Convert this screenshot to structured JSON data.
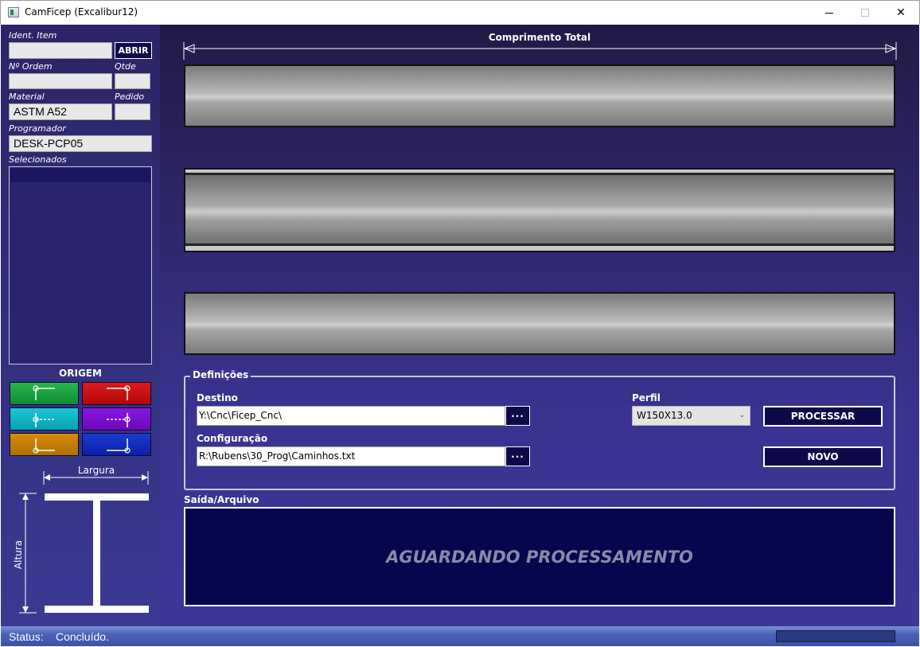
{
  "window": {
    "title": "CamFicep (Excalibur12)"
  },
  "left": {
    "ident_label": "Ident. Item",
    "ident_value": "",
    "abrir_label": "ABRIR",
    "ordem_label": "Nº Ordem",
    "ordem_value": "",
    "qtde_label": "Qtde",
    "qtde_value": "",
    "material_label": "Material",
    "material_value": "ASTM A52",
    "pedido_label": "Pedido",
    "pedido_value": "",
    "programador_label": "Programador",
    "programador_value": "DESK-PCP05",
    "selecionados_label": "Selecionados",
    "origem_title": "ORIGEM",
    "origem_buttons": [
      {
        "name": "top-left",
        "color": "#1aa040"
      },
      {
        "name": "top-right",
        "color": "#d01010"
      },
      {
        "name": "middle-left",
        "color": "#10b8c8"
      },
      {
        "name": "middle-right",
        "color": "#7a10d0"
      },
      {
        "name": "bottom-left",
        "color": "#c88000"
      },
      {
        "name": "bottom-right",
        "color": "#0a2ab8"
      }
    ],
    "largura_label": "Largura",
    "altura_label": "Altura"
  },
  "main": {
    "comprimento_label": "Comprimento Total",
    "definicoes_label": "Definições",
    "destino_label": "Destino",
    "destino_value": "Y:\\Cnc\\Ficep_Cnc\\",
    "configuracao_label": "Configuração",
    "configuracao_value": "R:\\Rubens\\30_Prog\\Caminhos.txt",
    "dots_label": "...",
    "perfil_label": "Perfil",
    "perfil_value": "W150X13.0",
    "processar_label": "PROCESSAR",
    "novo_label": "NOVO",
    "saida_label": "Saída/Arquivo",
    "output_text": "AGUARDANDO PROCESSAMENTO"
  },
  "status": {
    "label": "Status:",
    "value": "Concluído.",
    "progress": 0
  },
  "colors": {
    "panel_bg": "#34307e",
    "button_bg": "#0e0a4a",
    "output_bg": "#06064f"
  }
}
